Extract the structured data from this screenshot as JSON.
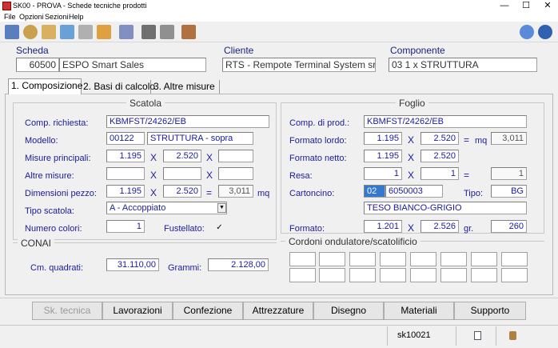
{
  "window": {
    "title": "SK00 - PROVA - Schede tecniche prodotti",
    "minimize": "—",
    "maximize": "☐",
    "close": "✕"
  },
  "menu": [
    "File",
    "Opzioni",
    "Sezioni",
    "Help"
  ],
  "header": {
    "scheda_label": "Scheda",
    "scheda_num": "60500",
    "scheda_desc": "ESPO Smart Sales",
    "cliente_label": "Cliente",
    "cliente_value": "RTS - Rempote Terminal System srl",
    "componente_label": "Componente",
    "componente_value": "03  1 x STRUTTURA"
  },
  "tabs": [
    "1. Composizione",
    "2. Basi di calcolo",
    "3. Altre misure"
  ],
  "scatola": {
    "title": "Scatola",
    "comp_label": "Comp. richiesta:",
    "comp_value": "KBMFST/24262/EB",
    "modello_label": "Modello:",
    "modello_code": "00122",
    "modello_desc": "STRUTTURA - sopra",
    "misure_label": "Misure principali:",
    "misure_1": "1.195",
    "misure_2": "2.520",
    "misure_3": "",
    "altre_label": "Altre misure:",
    "dim_label": "Dimensioni pezzo:",
    "dim_1": "1.195",
    "dim_2": "2.520",
    "dim_res": "3,011",
    "dim_unit": "mq",
    "tipo_label": "Tipo scatola:",
    "tipo_value": "A - Accoppiato",
    "colori_label": "Numero colori:",
    "colori_value": "1",
    "fustellato_label": "Fustellato:",
    "fustellato_check": "✓"
  },
  "conai": {
    "title": "CONAI",
    "cmq_label": "Cm. quadrati:",
    "cmq_value": "31.110,00",
    "grammi_label": "Grammi:",
    "grammi_value": "2.128,00"
  },
  "foglio": {
    "title": "Foglio",
    "comp_label": "Comp. di prod.:",
    "comp_value": "KBMFST/24262/EB",
    "lordo_label": "Formato lordo:",
    "lordo_1": "1.195",
    "lordo_2": "2.520",
    "lordo_mq": "3,011",
    "mq_label": "mq",
    "netto_label": "Formato netto:",
    "netto_1": "1.195",
    "netto_2": "2.520",
    "resa_label": "Resa:",
    "resa_1": "1",
    "resa_2": "1",
    "resa_res": "1",
    "cart_label": "Cartoncino:",
    "cart_code": "02",
    "cart_num": "6050003",
    "tipo_label": "Tipo:",
    "tipo_value": "BG",
    "cart_desc": "TESO BIANCO-GRIGIO",
    "formato_label": "Formato:",
    "formato_1": "1.201",
    "formato_2": "2.526",
    "gr_label": "gr.",
    "gr_value": "260"
  },
  "cordoni": {
    "title": "Cordoni ondulatore/scatolificio"
  },
  "symbols": {
    "x": "X",
    "eq": "="
  },
  "buttons": [
    "Sk. tecnica",
    "Lavorazioni",
    "Confezione",
    "Attrezzature",
    "Disegno",
    "Materiali",
    "Supporto"
  ],
  "status": {
    "code": "sk10021"
  },
  "toolbar_icons": [
    "print-icon",
    "search-icon",
    "edit-icon",
    "pencil-icon",
    "copy-icon",
    "brush-icon",
    "document-icon",
    "page-icon",
    "folder-icon",
    "exit-icon"
  ],
  "toolbar_right": [
    "help-search-icon",
    "info-icon"
  ]
}
